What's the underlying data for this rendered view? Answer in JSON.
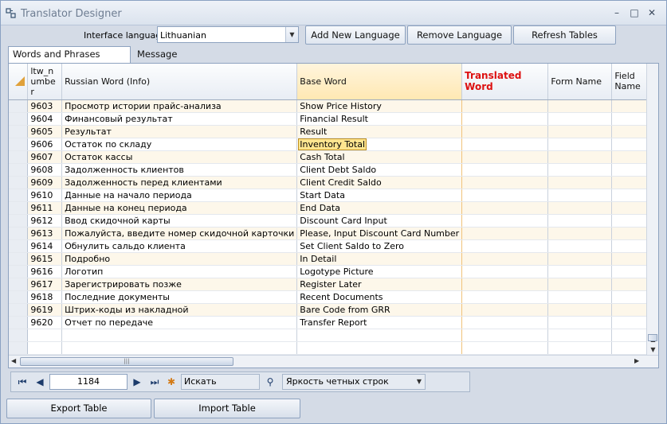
{
  "window": {
    "title": "Translator Designer",
    "controls": {
      "minimize": "–",
      "maximize": "□",
      "close": "✕"
    }
  },
  "toolbar": {
    "interface_language_label": "Interface language",
    "interface_language_value": "Lithuanian",
    "add_language": "Add New Language",
    "remove_language": "Remove Language",
    "refresh_tables": "Refresh Tables"
  },
  "tabs": [
    {
      "label": "Words and Phrases Translator",
      "active": true
    },
    {
      "label": "Message Translator",
      "active": false
    }
  ],
  "grid": {
    "columns": [
      "ltw_number",
      "Russian Word (Info)",
      "Base Word",
      "Translated Word",
      "Form Name",
      "Field Name"
    ],
    "rows": [
      [
        "9603",
        "Просмотр истории прайс-анализа",
        "Show Price History"
      ],
      [
        "9604",
        "Финансовый результат",
        "Financial Result"
      ],
      [
        "9605",
        "Результат",
        "Result"
      ],
      [
        "9606",
        "Остаток по складу",
        "Inventory Total"
      ],
      [
        "9607",
        "Остаток кассы",
        "Cash Total"
      ],
      [
        "9608",
        "Задолженность клиентов",
        "Client Debt Saldo"
      ],
      [
        "9609",
        "Задолженность перед клиентами",
        "Client Credit Saldo"
      ],
      [
        "9610",
        "Данные на начало периода",
        "Start Data"
      ],
      [
        "9611",
        "Данные на конец периода",
        "End Data"
      ],
      [
        "9612",
        "Ввод скидочной карты",
        "Discount Card Input"
      ],
      [
        "9613",
        "Пожалуйста, введите номер скидочной карточки",
        "Please, Input Discount Card Number"
      ],
      [
        "9614",
        "Обнулить сальдо клиента",
        "Set Client Saldo to Zero"
      ],
      [
        "9615",
        "Подробно",
        "In Detail"
      ],
      [
        "9616",
        "Логотип",
        "Logotype Picture"
      ],
      [
        "9617",
        "Зарегистрировать позже",
        "Register Later"
      ],
      [
        "9618",
        "Последние документы",
        "Recent Documents"
      ],
      [
        "9619",
        "Штрих-коды из накладной",
        "Bare Code from GRR"
      ],
      [
        "9620",
        "Отчет по передаче",
        "Transfer Report"
      ]
    ]
  },
  "navigator": {
    "position": "1184",
    "search_placeholder": "Искать",
    "stripe_option": "Яркость четных строк"
  },
  "bottom": {
    "export": "Export Table",
    "import": "Import Table"
  },
  "icons": [
    "app-icon",
    "first-record-icon",
    "prev-record-icon",
    "next-record-icon",
    "last-record-icon",
    "refresh-icon",
    "binoculars-icon"
  ]
}
